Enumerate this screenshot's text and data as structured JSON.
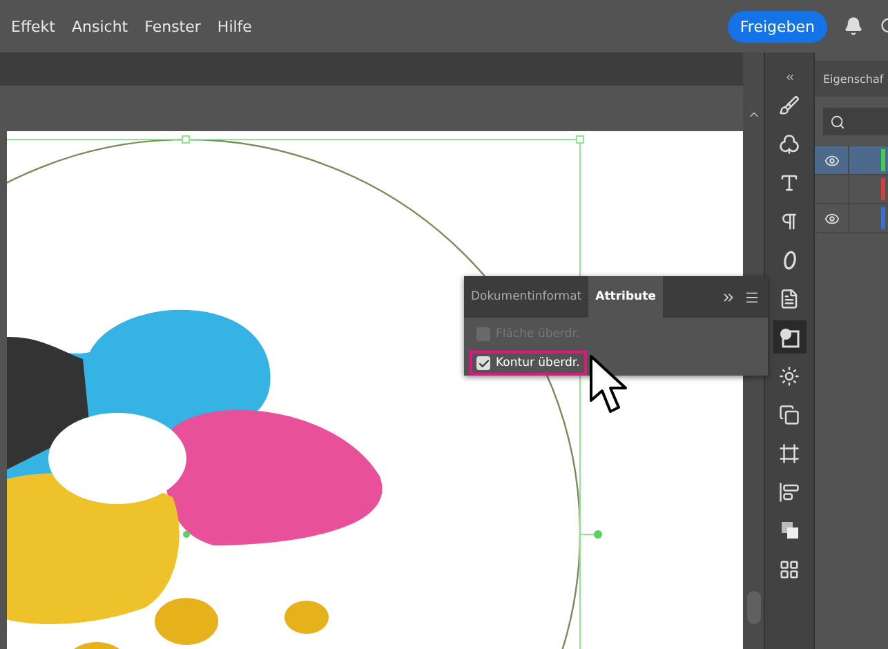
{
  "menu": [
    "Effekt",
    "Ansicht",
    "Fenster",
    "Hilfe"
  ],
  "share_button": "Freigeben",
  "panel": {
    "tabs": [
      {
        "label": "Dokumentinformat",
        "selected": false
      },
      {
        "label": "Attribute",
        "selected": true
      }
    ],
    "options": [
      {
        "label": "Fläche überdr.",
        "checked": false,
        "disabled": true,
        "highlighted": false
      },
      {
        "label": "Kontur überdr.",
        "checked": true,
        "disabled": false,
        "highlighted": true
      }
    ]
  },
  "tools": [
    {
      "kind": "brush",
      "selected": false
    },
    {
      "kind": "club",
      "selected": false
    },
    {
      "kind": "type",
      "selected": false
    },
    {
      "kind": "pilcrow",
      "selected": false
    },
    {
      "kind": "glyph",
      "selected": false
    },
    {
      "kind": "docinfo",
      "selected": false
    },
    {
      "kind": "attributes",
      "selected": true
    },
    {
      "kind": "sun",
      "selected": false
    },
    {
      "kind": "transform",
      "selected": false
    },
    {
      "kind": "frame",
      "selected": false
    },
    {
      "kind": "align",
      "selected": false
    },
    {
      "kind": "pathfinder",
      "selected": false
    },
    {
      "kind": "swatches",
      "selected": false
    }
  ],
  "right_panel": {
    "tab": "Eigenschaf",
    "layers": [
      {
        "visible": true,
        "selected": true,
        "color": "#3fcf4f"
      },
      {
        "visible": false,
        "selected": false,
        "color": "#d04040"
      },
      {
        "visible": true,
        "selected": false,
        "color": "#3a6fd0"
      }
    ]
  }
}
